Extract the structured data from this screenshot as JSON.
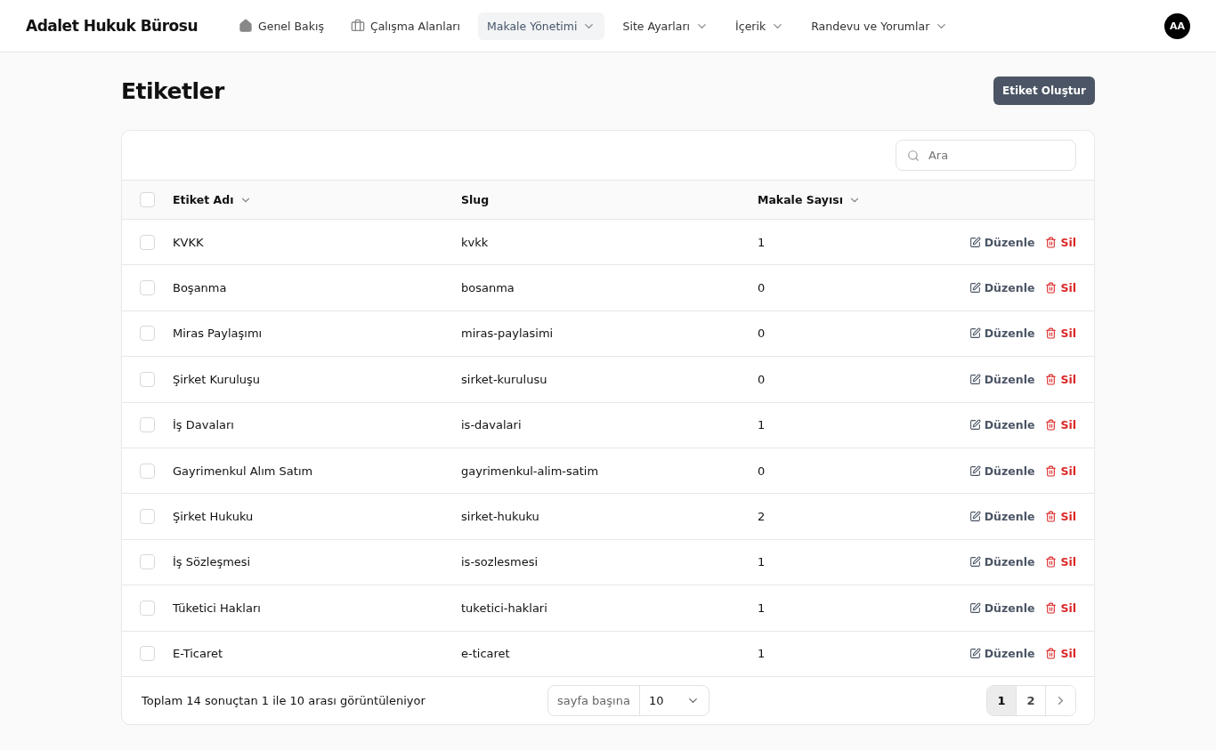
{
  "brand": "Adalet Hukuk Bürosu",
  "nav": [
    {
      "label": "Genel Bakış",
      "kind": "home",
      "selected": false
    },
    {
      "label": "Çalışma Alanları",
      "kind": "briefcase",
      "selected": false
    },
    {
      "label": "Makale Yönetimi",
      "kind": "dropdown",
      "selected": true
    },
    {
      "label": "Site Ayarları",
      "kind": "dropdown",
      "selected": false
    },
    {
      "label": "İçerik",
      "kind": "dropdown",
      "selected": false
    },
    {
      "label": "Randevu ve Yorumlar",
      "kind": "dropdown",
      "selected": false
    }
  ],
  "avatar": "AA",
  "page_title": "Etiketler",
  "create_button": "Etiket Oluştur",
  "search": {
    "placeholder": "Ara"
  },
  "table": {
    "select_all_checked": false,
    "columns": [
      {
        "label": "Etiket Adı",
        "sortable": true
      },
      {
        "label": "Slug",
        "sortable": false
      },
      {
        "label": "Makale Sayısı",
        "sortable": true
      }
    ],
    "rows": [
      {
        "name": "KVKK",
        "slug": "kvkk",
        "count": "1",
        "checked": false,
        "edit": "Düzenle",
        "delete": "Sil"
      },
      {
        "name": "Boşanma",
        "slug": "bosanma",
        "count": "0",
        "checked": false,
        "edit": "Düzenle",
        "delete": "Sil"
      },
      {
        "name": "Miras Paylaşımı",
        "slug": "miras-paylasimi",
        "count": "0",
        "checked": false,
        "edit": "Düzenle",
        "delete": "Sil"
      },
      {
        "name": "Şirket Kuruluşu",
        "slug": "sirket-kurulusu",
        "count": "0",
        "checked": false,
        "edit": "Düzenle",
        "delete": "Sil"
      },
      {
        "name": "İş Davaları",
        "slug": "is-davalari",
        "count": "1",
        "checked": false,
        "edit": "Düzenle",
        "delete": "Sil"
      },
      {
        "name": "Gayrimenkul Alım Satım",
        "slug": "gayrimenkul-alim-satim",
        "count": "0",
        "checked": false,
        "edit": "Düzenle",
        "delete": "Sil"
      },
      {
        "name": "Şirket Hukuku",
        "slug": "sirket-hukuku",
        "count": "2",
        "checked": false,
        "edit": "Düzenle",
        "delete": "Sil"
      },
      {
        "name": "İş Sözleşmesi",
        "slug": "is-sozlesmesi",
        "count": "1",
        "checked": false,
        "edit": "Düzenle",
        "delete": "Sil"
      },
      {
        "name": "Tüketici Hakları",
        "slug": "tuketici-haklari",
        "count": "1",
        "checked": false,
        "edit": "Düzenle",
        "delete": "Sil"
      },
      {
        "name": "E-Ticaret",
        "slug": "e-ticaret",
        "count": "1",
        "checked": false,
        "edit": "Düzenle",
        "delete": "Sil"
      }
    ]
  },
  "footer": {
    "summary": "Toplam 14 sonuçtan 1 ile 10 arası görüntüleniyor",
    "per_page_label": "sayfa başına",
    "per_page_value": "10",
    "pages": [
      {
        "label": "1",
        "selected": true
      },
      {
        "label": "2",
        "selected": false
      }
    ]
  }
}
